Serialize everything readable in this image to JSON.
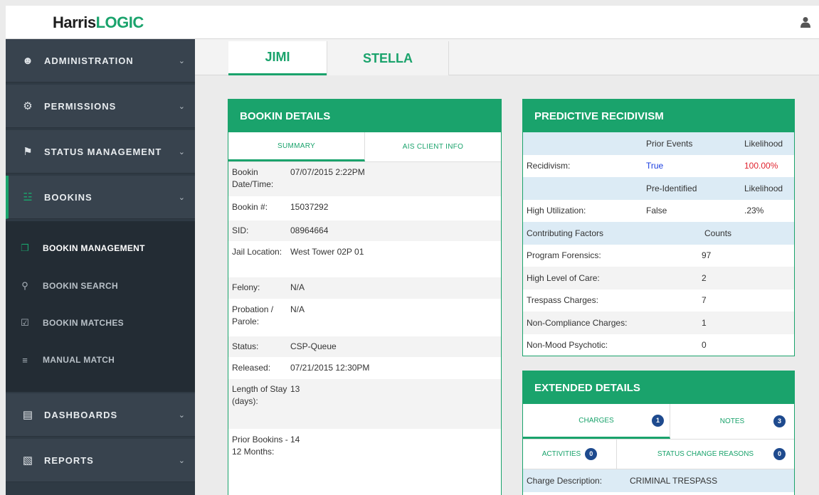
{
  "app": {
    "logo_main": "Harris",
    "logo_accent": "LOGIC"
  },
  "sidebar": {
    "items": [
      {
        "label": "ADMINISTRATION",
        "icon": "users-cog-icon"
      },
      {
        "label": "PERMISSIONS",
        "icon": "cogs-icon"
      },
      {
        "label": "STATUS MANAGEMENT",
        "icon": "tags-icon"
      },
      {
        "label": "BOOKINS",
        "icon": "group-icon"
      },
      {
        "label": "DASHBOARDS",
        "icon": "bar-chart-icon"
      },
      {
        "label": "REPORTS",
        "icon": "book-icon"
      }
    ],
    "submenu": [
      {
        "label": "BOOKIN MANAGEMENT",
        "icon": "copy-icon"
      },
      {
        "label": "BOOKIN SEARCH",
        "icon": "search-icon"
      },
      {
        "label": "BOOKIN MATCHES",
        "icon": "check-square-icon"
      },
      {
        "label": "MANUAL MATCH",
        "icon": "sliders-icon"
      }
    ]
  },
  "person_tabs": [
    "JIMI",
    "STELLA"
  ],
  "bookin": {
    "title": "BOOKIN DETAILS",
    "tabs": [
      "SUMMARY",
      "AIS CLIENT INFO"
    ],
    "rows": [
      {
        "k": "Bookin Date/Time:",
        "v": "07/07/2015 2:22PM"
      },
      {
        "k": "Bookin #:",
        "v": "15037292"
      },
      {
        "k": "SID:",
        "v": "08964664"
      },
      {
        "k": "Jail Location:",
        "v": "West Tower 02P 01"
      },
      {
        "k": "Felony:",
        "v": "N/A"
      },
      {
        "k": "Probation / Parole:",
        "v": "N/A"
      },
      {
        "k": "Status:",
        "v": "CSP-Queue"
      },
      {
        "k": "Released:",
        "v": "07/21/2015 12:30PM"
      },
      {
        "k": "Length of Stay (days):",
        "v": "13"
      },
      {
        "k": "Prior Bookins - 12 Months:",
        "v": "14"
      }
    ]
  },
  "recidivism": {
    "title": "PREDICTIVE RECIDIVISM",
    "h1": {
      "c1": "",
      "c2": "Prior Events",
      "c3": "Likelihood"
    },
    "r1": {
      "c1": "Recidivism:",
      "c2": "True",
      "c3": "100.00%"
    },
    "h2": {
      "c1": "",
      "c2": "Pre-Identified",
      "c3": "Likelihood"
    },
    "r2": {
      "c1": "High Utilization:",
      "c2": "False",
      "c3": ".23%"
    },
    "h3": {
      "c1": "Contributing Factors",
      "c2": "",
      "c3": "Counts"
    },
    "factors": [
      {
        "label": "Program Forensics:",
        "count": "97"
      },
      {
        "label": "High Level of Care:",
        "count": "2"
      },
      {
        "label": "Trespass Charges:",
        "count": "7"
      },
      {
        "label": "Non-Compliance Charges:",
        "count": "1"
      },
      {
        "label": "Non-Mood Psychotic:",
        "count": "0"
      }
    ]
  },
  "extended": {
    "title": "EXTENDED DETAILS",
    "tabs_row1": [
      {
        "label": "CHARGES",
        "badge": "1"
      },
      {
        "label": "NOTES",
        "badge": "3"
      }
    ],
    "tabs_row2": [
      {
        "label": "ACTIVITIES",
        "badge": "0"
      },
      {
        "label": "STATUS CHANGE REASONS",
        "badge": "0"
      }
    ],
    "charge_label": "Charge Description:",
    "charge_value": "CRIMINAL TRESPASS"
  },
  "colors": {
    "accent": "#1aa36c",
    "sidebar": "#2f3a44",
    "badge": "#1e4a8e"
  }
}
